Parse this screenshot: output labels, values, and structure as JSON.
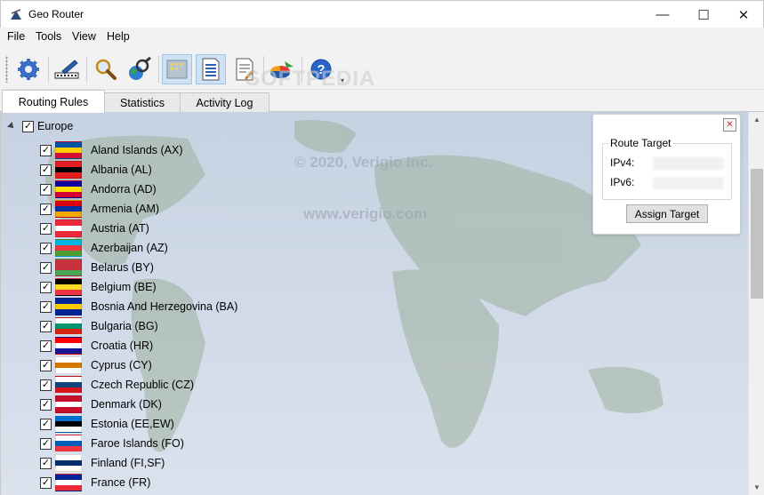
{
  "window": {
    "title": "Geo Router",
    "minimize": "—",
    "maximize": "☐",
    "close": "✕"
  },
  "menu": [
    "File",
    "Tools",
    "View",
    "Help"
  ],
  "toolbar": {
    "buttons": [
      "settings-icon",
      "edit-icon",
      "search-icon",
      "find-globe-icon",
      "map-view-icon",
      "list-view-icon",
      "document-view-icon",
      "statistics-icon",
      "help-icon"
    ],
    "more": "▾"
  },
  "watermarks": {
    "softpedia": "SOFTPEDIA",
    "copyright": "© 2020, Verigio Inc.",
    "website": "www.verigio.com"
  },
  "tabs": [
    "Routing Rules",
    "Statistics",
    "Activity Log"
  ],
  "tree": {
    "group": "Europe",
    "countries": [
      {
        "name": "Aland Islands  (AX)",
        "flag": [
          "#0053a5",
          "#ffce00",
          "#d21034"
        ]
      },
      {
        "name": "Albania  (AL)",
        "flag": [
          "#e41e20",
          "#000000",
          "#e41e20"
        ]
      },
      {
        "name": "Andorra  (AD)",
        "flag": [
          "#10069f",
          "#fedd00",
          "#d50032"
        ]
      },
      {
        "name": "Armenia  (AM)",
        "flag": [
          "#d90012",
          "#0033a0",
          "#f2a800"
        ]
      },
      {
        "name": "Austria  (AT)",
        "flag": [
          "#ed2939",
          "#ffffff",
          "#ed2939"
        ]
      },
      {
        "name": "Azerbaijan  (AZ)",
        "flag": [
          "#00b5e2",
          "#ef3340",
          "#509e2f"
        ]
      },
      {
        "name": "Belarus  (BY)",
        "flag": [
          "#c8313e",
          "#c8313e",
          "#4aa657"
        ]
      },
      {
        "name": "Belgium  (BE)",
        "flag": [
          "#000000",
          "#fdda24",
          "#ef3340"
        ]
      },
      {
        "name": "Bosnia And Herzegovina  (BA)",
        "flag": [
          "#002395",
          "#fecb00",
          "#002395"
        ]
      },
      {
        "name": "Bulgaria  (BG)",
        "flag": [
          "#ffffff",
          "#00966e",
          "#d62612"
        ]
      },
      {
        "name": "Croatia  (HR)",
        "flag": [
          "#ff0000",
          "#ffffff",
          "#171796"
        ]
      },
      {
        "name": "Cyprus  (CY)",
        "flag": [
          "#ffffff",
          "#d57800",
          "#ffffff"
        ]
      },
      {
        "name": "Czech Republic  (CZ)",
        "flag": [
          "#ffffff",
          "#11457e",
          "#d7141a"
        ]
      },
      {
        "name": "Denmark  (DK)",
        "flag": [
          "#c8102e",
          "#ffffff",
          "#c8102e"
        ]
      },
      {
        "name": "Estonia  (EE,EW)",
        "flag": [
          "#0072ce",
          "#000000",
          "#ffffff"
        ]
      },
      {
        "name": "Faroe Islands  (FO)",
        "flag": [
          "#ffffff",
          "#005eb8",
          "#ef3340"
        ]
      },
      {
        "name": "Finland  (FI,SF)",
        "flag": [
          "#ffffff",
          "#002f6c",
          "#ffffff"
        ]
      },
      {
        "name": "France  (FR)",
        "flag": [
          "#002395",
          "#ffffff",
          "#ed2939"
        ]
      }
    ]
  },
  "route_panel": {
    "close": "✕",
    "legend": "Route Target",
    "ipv4_label": "IPv4:",
    "ipv6_label": "IPv6:",
    "assign_button": "Assign Target"
  }
}
